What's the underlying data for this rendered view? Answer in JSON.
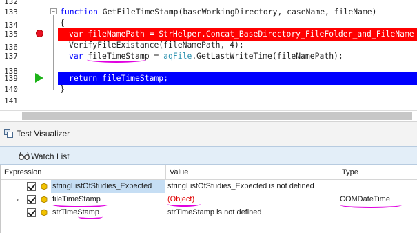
{
  "editor": {
    "lines": [
      {
        "num": "132",
        "text": ""
      },
      {
        "num": "133",
        "kw": "function",
        "rest": " GetFileTimeStamp(baseWorkingDirectory, caseName, fileName)"
      },
      {
        "num": "134",
        "text": "{"
      },
      {
        "num": "135",
        "kw": "var",
        "rest": " fileNamePath = StrHelper.Concat_BaseDirectory_FileFolder_and_FileName"
      },
      {
        "num": "136",
        "text": "VerifyFileExistance(fileNamePath, 4);"
      },
      {
        "num": "137",
        "kw": "var",
        "mid1": " fileTimeStamp = ",
        "type": "aqFile",
        "mid2": ".GetLastWriteTime(fileNamePath);"
      },
      {
        "num": "138",
        "text": ""
      },
      {
        "num": "139",
        "kw": "return",
        "rest": " fileTimeStamp;"
      },
      {
        "num": "140",
        "text": "}"
      },
      {
        "num": "141",
        "text": ""
      }
    ],
    "fold_open_glyph": "−",
    "breakpoint_line": "135",
    "execution_line": "139"
  },
  "test_visualizer": {
    "title": "Test Visualizer",
    "icon": "test-visualizer-icon"
  },
  "watch_list": {
    "title": "Watch List",
    "icon": "glasses-icon",
    "columns": [
      "Expression",
      "Value",
      "Type"
    ],
    "rows": [
      {
        "expander": "",
        "checked": true,
        "expression": "stringListOfStudies_Expected",
        "value": "stringListOfStudies_Expected is not defined",
        "type": ""
      },
      {
        "expander": "›",
        "checked": true,
        "expression": "fileTimeStamp",
        "value": "(Object)",
        "type": "COMDateTime"
      },
      {
        "expander": "",
        "checked": true,
        "expression": "strTimeStamp",
        "value": "strTimeStamp is not defined",
        "type": ""
      }
    ]
  },
  "colors": {
    "breakpoint_line_bg": "#ff0000",
    "execution_line_bg": "#0000ff",
    "keyword": "#0000ff",
    "annotation_ink": "#e000e0",
    "object_value": "#e00000",
    "selection": "#c6def4"
  }
}
